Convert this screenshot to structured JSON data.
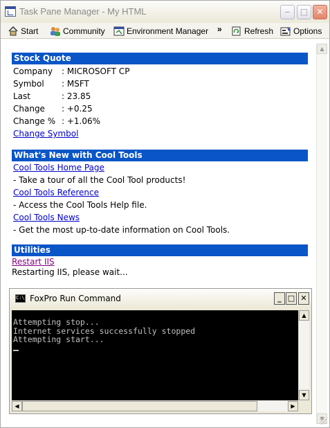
{
  "window": {
    "title": "Task Pane Manager - My HTML",
    "controls": {
      "minimize": "‒",
      "maximize": "□",
      "close": "✕"
    }
  },
  "toolbar": {
    "start_label": "Start",
    "community_label": "Community",
    "environment_label": "Environment Manager",
    "more_label": "»",
    "refresh_label": "Refresh",
    "options_label": "Options"
  },
  "stock_quote": {
    "heading": "Stock Quote",
    "rows": [
      {
        "key": "Company",
        "value": ": MICROSOFT CP"
      },
      {
        "key": "Symbol",
        "value": ": MSFT"
      },
      {
        "key": "Last",
        "value": ": 23.85"
      },
      {
        "key": "Change",
        "value": ": +0.25"
      },
      {
        "key": "Change %",
        "value": ": +1.06%"
      }
    ],
    "change_link": "Change Symbol"
  },
  "whats_new": {
    "heading": "What's New with Cool Tools",
    "items": [
      {
        "link": "Cool Tools Home Page",
        "desc": "- Take a tour of all the Cool Tool products!"
      },
      {
        "link": "Cool Tools Reference",
        "desc": "- Access the Cool Tools Help file."
      },
      {
        "link": "Cool Tools News",
        "desc": "- Get the most up-to-date information on Cool Tools."
      }
    ]
  },
  "utilities": {
    "heading": "Utilities",
    "restart_link": "Restart IIS",
    "status": "Restarting IIS, please wait..."
  },
  "console": {
    "title": "FoxPro Run Command",
    "icon_text": "C:\\",
    "lines": [
      "Attempting stop...",
      "Internet services successfully stopped",
      "Attempting start..."
    ]
  },
  "colors": {
    "section_header": "#0a55c7",
    "link": "#0000cc",
    "visited_link": "#800080",
    "console_bg": "#000000",
    "console_text": "#c0c0c0"
  },
  "icons": {
    "start": "house-icon",
    "community": "people-icon",
    "environment": "environment-icon",
    "refresh": "refresh-icon",
    "options": "options-icon"
  }
}
